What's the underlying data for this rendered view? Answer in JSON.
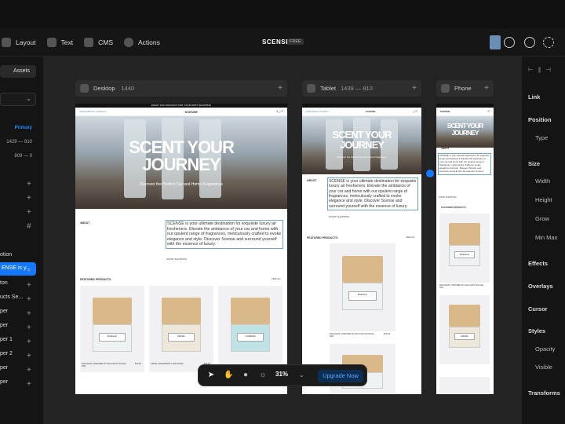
{
  "toolbar": {
    "layout": "Layout",
    "text": "Text",
    "cms": "CMS",
    "actions": "Actions",
    "project_title": "SCENSE",
    "plan_badge": "FREE"
  },
  "left_panel": {
    "assets_tab": "Assets",
    "breakpoints": [
      {
        "label": "Primary",
        "accent": "#1a8cff"
      },
      {
        "label": "1429 — 810"
      },
      {
        "label": "809 — 0"
      }
    ],
    "layers": [
      "otion",
      "ENSE is y...",
      "ton",
      "ucts Se...",
      "per",
      "per",
      "per 1",
      "per 2",
      "per",
      "per"
    ]
  },
  "frames": {
    "desktop": {
      "label": "Desktop",
      "size": "1440"
    },
    "tablet": {
      "label": "Tablet",
      "size": "1439 — 810"
    },
    "phone": {
      "label": "Phone"
    }
  },
  "site": {
    "banner": "ENJOY 10% DISCOUNT FOR YOUR FIRST SHOPPING",
    "logo": "SCENSE",
    "nav": "SHOP  ABOUT  CONTACT",
    "hero_line1": "SCENT YOUR",
    "hero_line2": "JOURNEY",
    "hero_sub": "Discover the Perfect Car and Home Fragrances",
    "about_label": "ABOUT",
    "about_text": "SCENSE is your ultimate destination for exquisite luxury air fresheners. Elevate the ambiance of your car and home with our opulent range of fragrances, meticulously crafted to evoke elegance and style. Discover Scense and surround yourself with the essence of luxury.",
    "start_shopping": "START SHOPPING",
    "featured_label": "FEATURED PRODUCTS",
    "view_all": "VIEW ALL",
    "products": [
      {
        "label": "Bakkarat",
        "name": "BAKKARAT (INSPIRED BY BACCARAT ROUGE 540)",
        "price": "$16.99",
        "cap": "#d9b98a",
        "liquid": "#f4f4f4"
      },
      {
        "label": "AMOEL",
        "name": "AMOEL (INSPIRED BY AMOUAGE)",
        "price": "$16.99",
        "cap": "#d9b98a",
        "liquid": "#ece7d8"
      },
      {
        "label": "LUMIERE",
        "name": "LUMIERE (INSPIRED BY ...)",
        "price": "$16.99",
        "cap": "#d9b98a",
        "liquid": "#bfe3e4"
      }
    ]
  },
  "right_panel": {
    "sections": [
      "Link",
      "Position",
      "Type",
      "Size",
      "Width",
      "Height",
      "Grow",
      "Min Max",
      "Effects",
      "Overlays",
      "Cursor",
      "Styles",
      "Opacity",
      "Visible",
      "Transforms"
    ]
  },
  "bottom_bar": {
    "zoom": "31%",
    "upgrade": "Upgrade Now",
    "upgrade_color": "#0c2e53"
  }
}
